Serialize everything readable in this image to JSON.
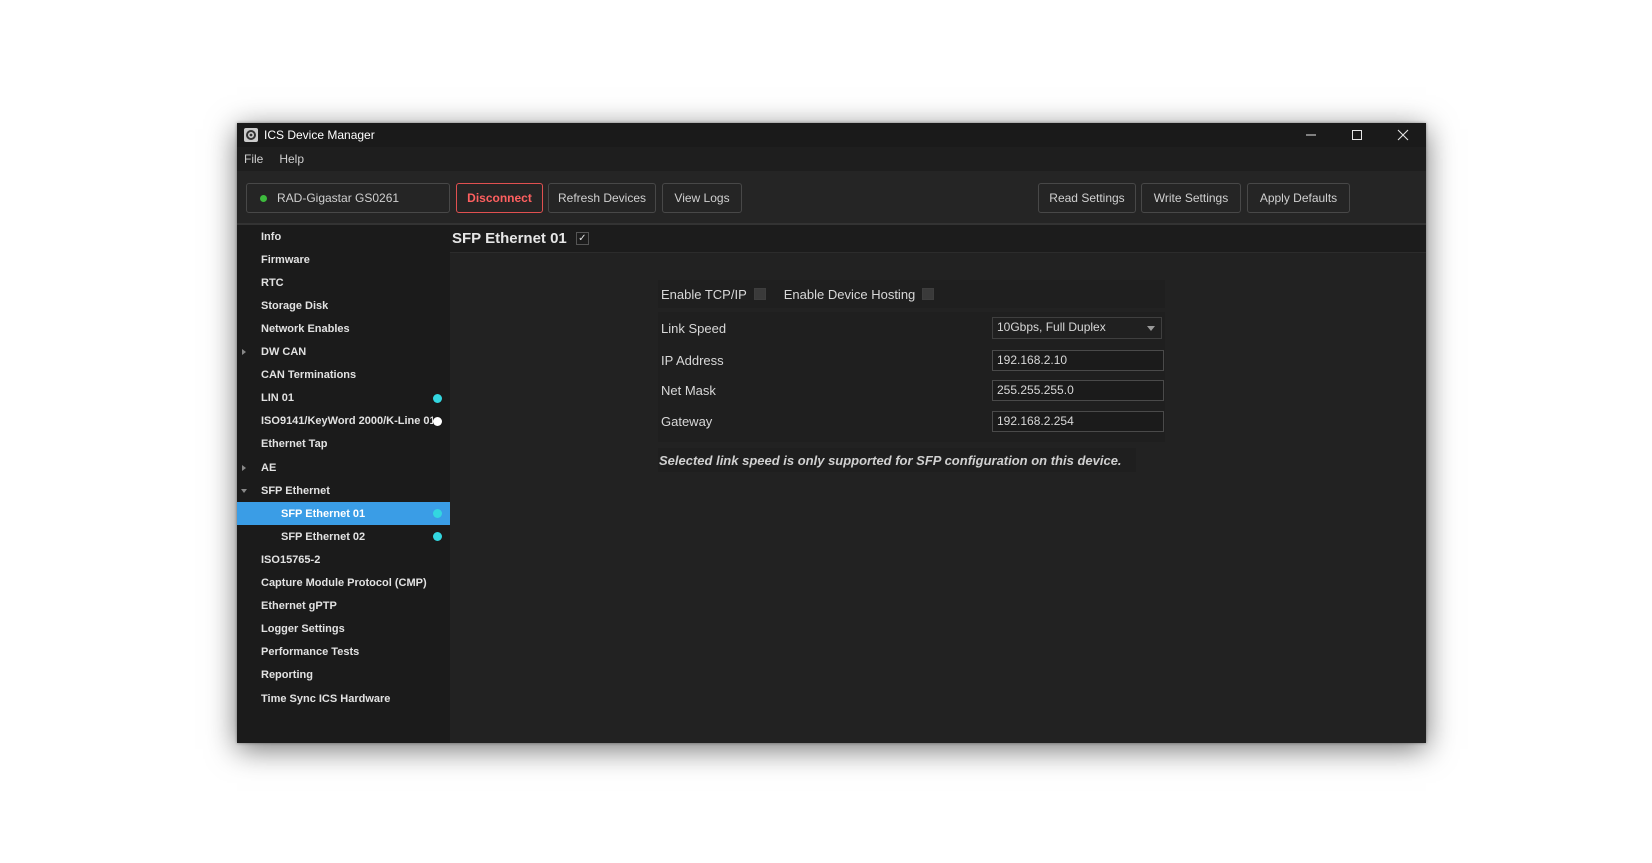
{
  "window": {
    "title": "ICS Device Manager",
    "controls": {
      "minimize": "─",
      "maximize": "☐",
      "close": "✕"
    }
  },
  "menu": {
    "items": [
      "File",
      "Help"
    ]
  },
  "toolbar": {
    "device": {
      "name": "RAD-Gigastar GS0261",
      "status_color": "#3dbb3d"
    },
    "disconnect_label": "Disconnect",
    "refresh_label": "Refresh Devices",
    "view_logs_label": "View Logs",
    "read_settings_label": "Read Settings",
    "write_settings_label": "Write Settings",
    "apply_defaults_label": "Apply Defaults"
  },
  "sidebar": {
    "items": [
      {
        "label": "Info"
      },
      {
        "label": "Firmware"
      },
      {
        "label": "RTC"
      },
      {
        "label": "Storage Disk"
      },
      {
        "label": "Network Enables"
      },
      {
        "label": "DW CAN",
        "expander": "collapsed"
      },
      {
        "label": "CAN Terminations"
      },
      {
        "label": "LIN 01",
        "status": "#33d6e0"
      },
      {
        "label": "ISO9141/KeyWord 2000/K-Line 01",
        "status": "#ffffff"
      },
      {
        "label": "Ethernet Tap"
      },
      {
        "label": "AE",
        "expander": "collapsed"
      },
      {
        "label": "SFP Ethernet",
        "expander": "expanded"
      },
      {
        "label": "SFP Ethernet 01",
        "child": true,
        "selected": true,
        "status": "#33d6e0"
      },
      {
        "label": "SFP Ethernet 02",
        "child": true,
        "status": "#33d6e0"
      },
      {
        "label": "ISO15765-2"
      },
      {
        "label": "Capture Module Protocol (CMP)"
      },
      {
        "label": "Ethernet gPTP"
      },
      {
        "label": "Logger Settings"
      },
      {
        "label": "Performance Tests"
      },
      {
        "label": "Reporting"
      },
      {
        "label": "Time Sync ICS Hardware"
      }
    ]
  },
  "content": {
    "title": "SFP Ethernet 01",
    "title_check": "✓",
    "enable_tcpip_label": "Enable TCP/IP",
    "enable_tcpip_checked": false,
    "enable_hosting_label": "Enable Device Hosting",
    "enable_hosting_checked": false,
    "link_speed_label": "Link Speed",
    "link_speed_value": "10Gbps, Full Duplex",
    "ip_label": "IP Address",
    "ip_value": "192.168.2.10",
    "mask_label": "Net Mask",
    "mask_value": "255.255.255.0",
    "gateway_label": "Gateway",
    "gateway_value": "192.168.2.254",
    "note": "Selected link speed is only supported for SFP configuration on this device."
  },
  "colors": {
    "selected": "#3a9de6",
    "disconnect": "#ff6060",
    "status_cyan": "#33d6e0"
  }
}
